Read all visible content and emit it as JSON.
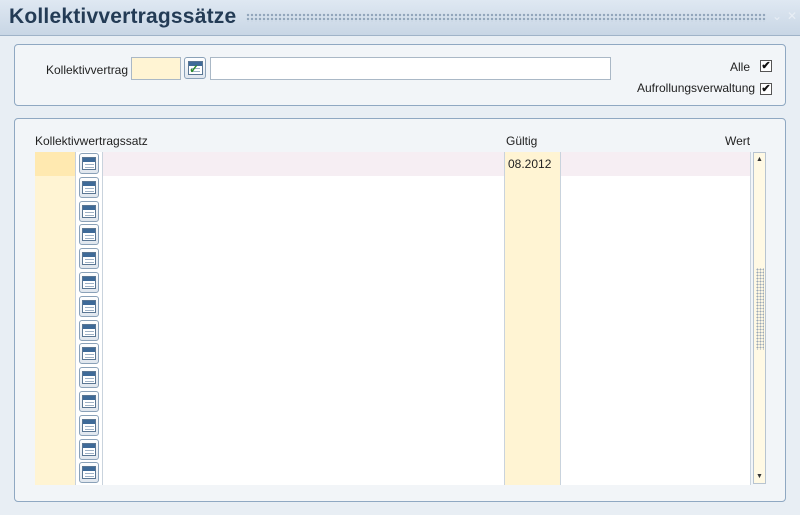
{
  "window": {
    "title": "Kollektivvertragssätze",
    "minimize_glyph": "⌄",
    "close_glyph": "✕"
  },
  "filter": {
    "kollektivvertrag_label": "Kollektivvertrag",
    "code_value": "",
    "description_value": "",
    "alle_label": "Alle",
    "alle_checked": "✔",
    "aufrollung_label": "Aufrollungsverwaltung",
    "aufrollung_checked": "✔"
  },
  "table": {
    "columns": {
      "satz": "Kollektivwertragssatz",
      "gueltig": "Gültig",
      "wert": "Wert"
    },
    "rows": [
      {
        "code": "",
        "satz": "",
        "gueltig": "08.2012",
        "wert": ""
      },
      {
        "code": "",
        "satz": "",
        "gueltig": "",
        "wert": ""
      },
      {
        "code": "",
        "satz": "",
        "gueltig": "",
        "wert": ""
      },
      {
        "code": "",
        "satz": "",
        "gueltig": "",
        "wert": ""
      },
      {
        "code": "",
        "satz": "",
        "gueltig": "",
        "wert": ""
      },
      {
        "code": "",
        "satz": "",
        "gueltig": "",
        "wert": ""
      },
      {
        "code": "",
        "satz": "",
        "gueltig": "",
        "wert": ""
      },
      {
        "code": "",
        "satz": "",
        "gueltig": "",
        "wert": ""
      },
      {
        "code": "",
        "satz": "",
        "gueltig": "",
        "wert": ""
      },
      {
        "code": "",
        "satz": "",
        "gueltig": "",
        "wert": ""
      },
      {
        "code": "",
        "satz": "",
        "gueltig": "",
        "wert": ""
      },
      {
        "code": "",
        "satz": "",
        "gueltig": "",
        "wert": ""
      },
      {
        "code": "",
        "satz": "",
        "gueltig": "",
        "wert": ""
      },
      {
        "code": "",
        "satz": "",
        "gueltig": "",
        "wert": ""
      }
    ]
  },
  "scrollbar": {
    "up_glyph": "▲",
    "down_glyph": "▼"
  },
  "icons": {
    "lov": "calendar-list-icon",
    "lov_check": "calendar-check-icon"
  }
}
